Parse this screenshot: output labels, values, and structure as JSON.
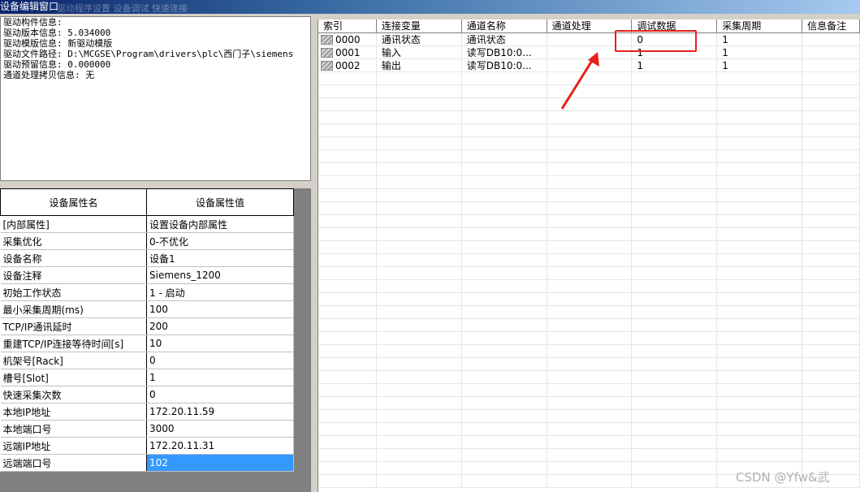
{
  "window": {
    "title": "设备编辑窗口",
    "ghost_menu": "驱动程序设置   设备调试   快速连接"
  },
  "driver_info": {
    "lines": [
      "驱动构件信息:",
      "驱动版本信息: 5.034000",
      "驱动模版信息: 新驱动模版",
      "驱动文件路径: D:\\MCGSE\\Program\\drivers\\plc\\西门子\\siemens",
      "驱动预留信息: 0.000000",
      "通道处理拷贝信息: 无"
    ]
  },
  "properties": {
    "header_name": "设备属性名",
    "header_value": "设备属性值",
    "rows": [
      {
        "name": "[内部属性]",
        "value": "设置设备内部属性"
      },
      {
        "name": "采集优化",
        "value": "0-不优化"
      },
      {
        "name": "设备名称",
        "value": "设备1"
      },
      {
        "name": "设备注释",
        "value": "Siemens_1200"
      },
      {
        "name": "初始工作状态",
        "value": "1 - 启动"
      },
      {
        "name": "最小采集周期(ms)",
        "value": "100"
      },
      {
        "name": "TCP/IP通讯延时",
        "value": "200"
      },
      {
        "name": "重建TCP/IP连接等待时间[s]",
        "value": "10"
      },
      {
        "name": "机架号[Rack]",
        "value": "0"
      },
      {
        "name": "槽号[Slot]",
        "value": "1"
      },
      {
        "name": "快速采集次数",
        "value": "0"
      },
      {
        "name": "本地IP地址",
        "value": "172.20.11.59"
      },
      {
        "name": "本地端口号",
        "value": "3000"
      },
      {
        "name": "远端IP地址",
        "value": "172.20.11.31"
      },
      {
        "name": "远端端口号",
        "value": "102"
      }
    ],
    "selected_row": 14
  },
  "channels": {
    "columns": [
      "索引",
      "连接变量",
      "通道名称",
      "通道处理",
      "调试数据",
      "采集周期",
      "信息备注"
    ],
    "rows": [
      {
        "index": "0000",
        "var": "通讯状态",
        "name": "通讯状态",
        "proc": "",
        "debug": "0",
        "period": "1",
        "note": ""
      },
      {
        "index": "0001",
        "var": "输入",
        "name": "读写DB10:0...",
        "proc": "",
        "debug": "1",
        "period": "1",
        "note": ""
      },
      {
        "index": "0002",
        "var": "输出",
        "name": "读写DB10:0...",
        "proc": "",
        "debug": "1",
        "period": "1",
        "note": ""
      }
    ],
    "empty_rows": 32
  },
  "annotation": {
    "color": "#e8201a"
  },
  "watermark": "CSDN @Yfw&武"
}
